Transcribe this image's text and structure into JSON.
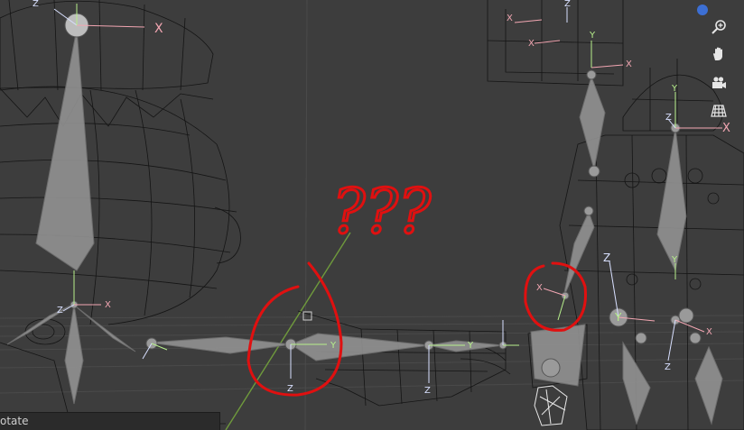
{
  "viewport": {
    "background": "#3d3d3d",
    "wire_color": "#151515",
    "bone_fill": "#8f8f8f",
    "bone_stroke": "#6d6d6d",
    "annotation_color": "#e01010",
    "annotation_text": "???",
    "gizmo_colors": {
      "x": "#f2a6b2",
      "y": "#b7f08c",
      "z": "#d8e0ff"
    },
    "axis_labels": {
      "x": "X",
      "y": "Y",
      "z": "Z"
    }
  },
  "navigation_gizmo": {
    "zoom_icon": "zoom-in-icon",
    "pan_icon": "hand-pan-icon",
    "camera_icon": "camera-view-icon",
    "ortho_icon": "ortho-grid-icon",
    "accent": "#3c6fd4"
  },
  "status_bar": {
    "hint_text": "otate"
  }
}
